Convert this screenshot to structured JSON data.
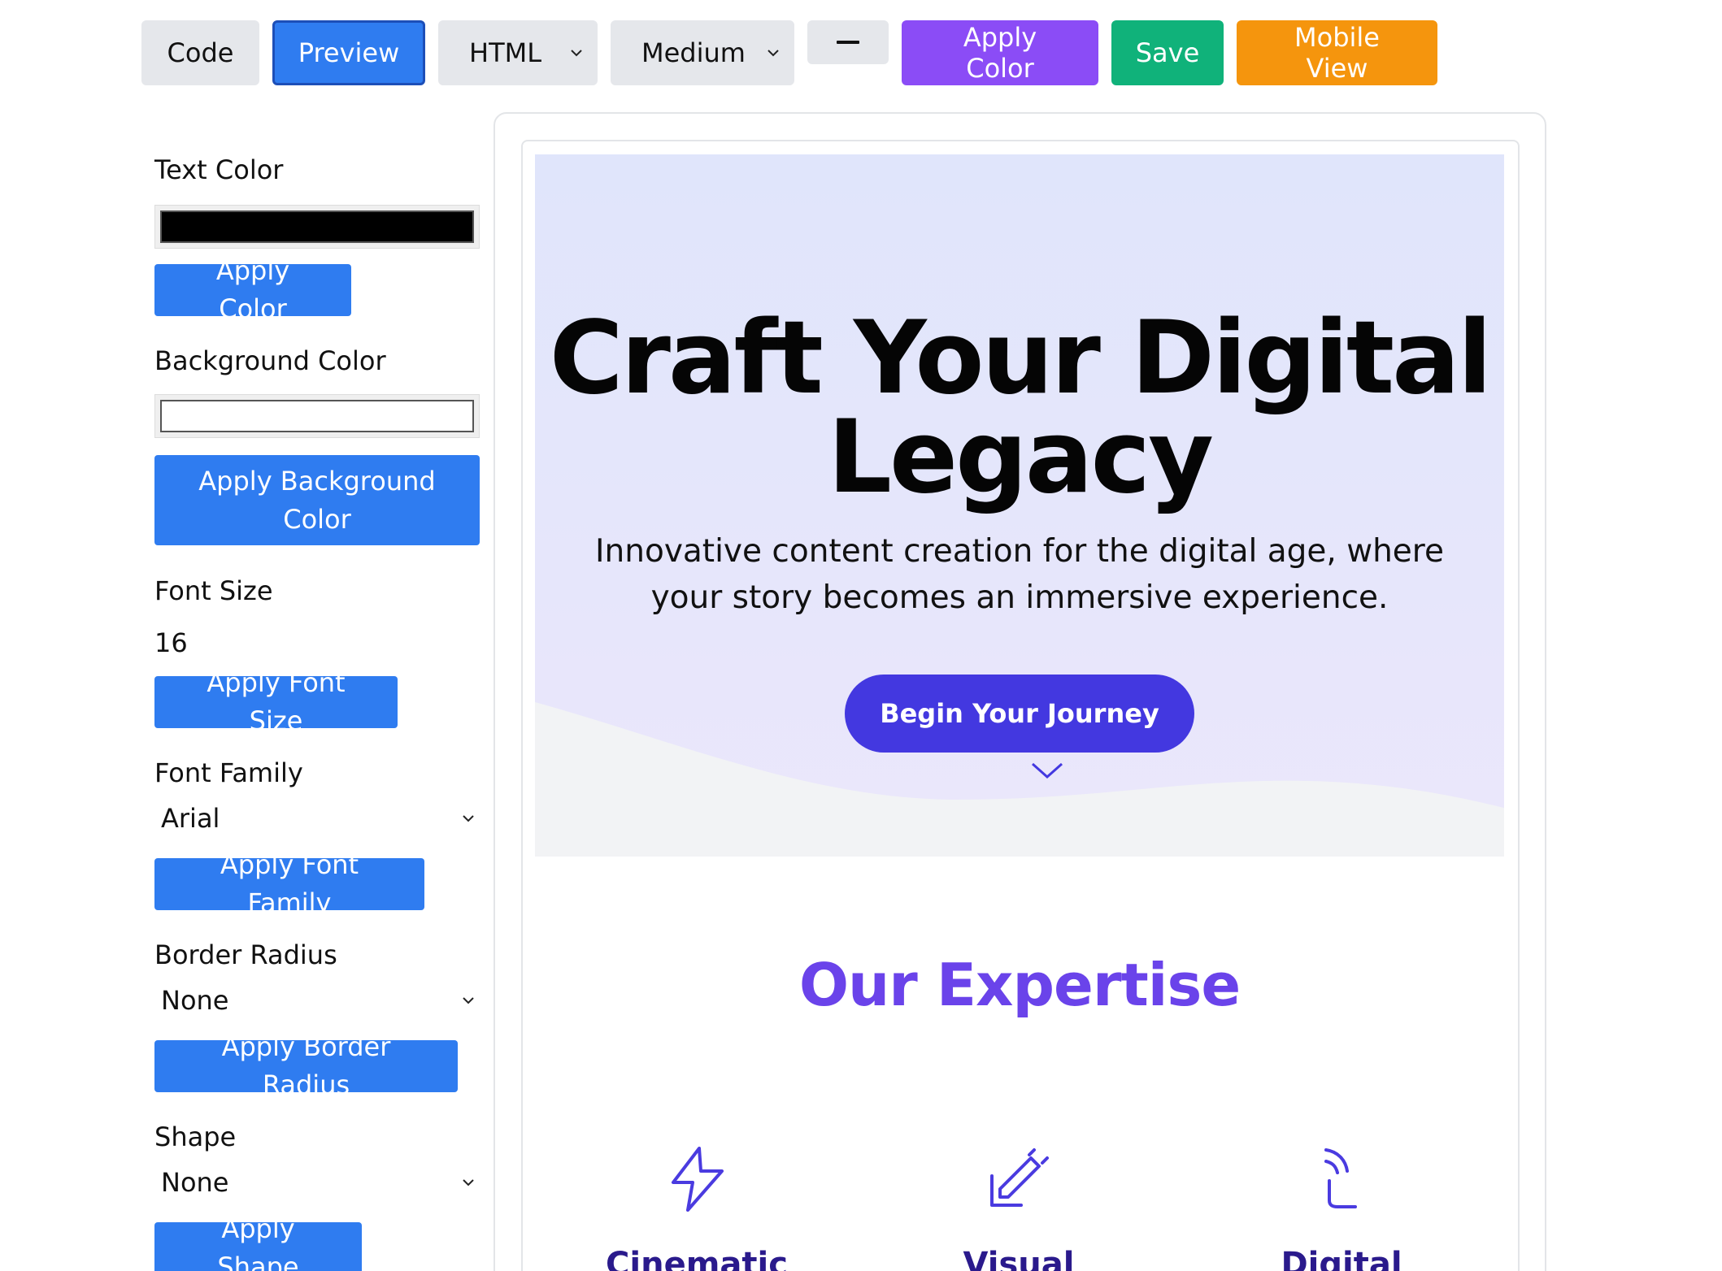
{
  "toolbar": {
    "code_label": "Code",
    "preview_label": "Preview",
    "language_value": "HTML",
    "size_value": "Medium",
    "apply_color_label": "Apply Color",
    "save_label": "Save",
    "mobile_view_label": "Mobile View"
  },
  "sidebar": {
    "text_color_label": "Text Color",
    "text_color_value": "#000000",
    "apply_color_label": "Apply Color",
    "bg_color_label": "Background Color",
    "bg_color_value": "#ffffff",
    "apply_bg_label": "Apply Background Color",
    "font_size_label": "Font Size",
    "font_size_value": "16",
    "apply_font_size_label": "Apply Font Size",
    "font_family_label": "Font Family",
    "font_family_value": "Arial",
    "apply_font_family_label": "Apply Font Family",
    "border_radius_label": "Border Radius",
    "border_radius_value": "None",
    "apply_border_radius_label": "Apply Border Radius",
    "shape_label": "Shape",
    "shape_value": "None",
    "apply_shape_label": "Apply Shape"
  },
  "preview": {
    "hero_title_line1": "Craft Your Digital",
    "hero_title_line2": "Legacy",
    "hero_subtitle": "Innovative content creation for the digital age, where your story becomes an immersive experience.",
    "cta_label": "Begin Your Journey",
    "section_title": "Our Expertise",
    "features": [
      {
        "title": "Cinematic",
        "icon": "lightning-icon"
      },
      {
        "title": "Visual",
        "icon": "pencil-edit-icon"
      },
      {
        "title": "Digital",
        "icon": "phone-icon"
      }
    ]
  },
  "colors": {
    "accent_blue": "#2f7cf0",
    "accent_purple": "#8b4cf6",
    "save_green": "#10b27a",
    "mobile_orange": "#f5950d",
    "cta_indigo": "#4338e0",
    "heading_purple": "#6a43ea"
  }
}
